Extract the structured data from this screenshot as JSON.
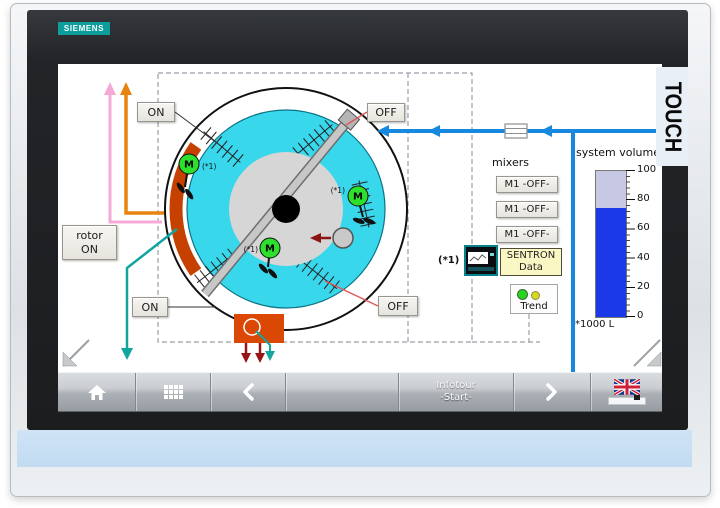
{
  "device": {
    "brand_logo": "SIEMENS",
    "bezel_label": "TOUCH"
  },
  "hmi": {
    "buttons": {
      "mixer_top_on": "ON",
      "scraper_off": "OFF",
      "rotor_line1": "rotor",
      "rotor_line2": "ON",
      "mixer_bottom_on": "ON",
      "pump_off": "OFF"
    },
    "tank": {
      "motor_label": "M",
      "motor_note": "(*1)"
    },
    "mixers_panel": {
      "title": "mixers",
      "items": [
        "M1 -OFF-",
        "M1 -OFF-",
        "M1 -OFF-"
      ]
    },
    "sentron": {
      "note": "(*1)",
      "label_line1": "SENTRON",
      "label_line2": "Data"
    },
    "trend": {
      "label": "Trend",
      "led_colors": [
        "#2ad41e",
        "#d8d81e"
      ]
    },
    "gauge": {
      "title": "system volume",
      "unit": "*1000 L",
      "ticks": [
        "100",
        "80",
        "60",
        "40",
        "20",
        "0"
      ],
      "value_percent": 75,
      "fill_color": "#1c39e8",
      "empty_color": "#c6c8e4"
    },
    "colors": {
      "tank_liquid": "#38d7ec",
      "pipe_blue": "#1788e0",
      "rotor_orange": "#c64100",
      "outlet_orange": "#db4806",
      "motor_green": "#2ce02c",
      "alarm_red": "#991414",
      "line_pink": "#f5a9d6",
      "line_orange": "#e8830f",
      "line_teal": "#12a49e",
      "siemens_teal": "#0e9d9d"
    }
  },
  "navbar": {
    "infotour_line1": "Infotour",
    "infotour_line2": "-Start-",
    "icons": [
      "home-icon",
      "keyboard-icon",
      "chevron-left-icon",
      "chevron-right-icon",
      "uk-flag-icon"
    ]
  }
}
